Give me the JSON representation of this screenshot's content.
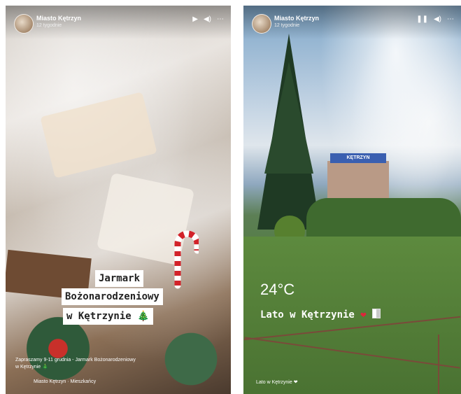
{
  "left_story": {
    "account_name": "Miasto Kętrzyn",
    "account_sub": "12 tygodnie",
    "controls": {
      "play": "▶",
      "sound": "◀)",
      "more": "⋯"
    },
    "caption_lines": [
      "Jarmark",
      "Bożonarodzeniowy",
      "w Kętrzynie 🎄"
    ],
    "bottom_line1": "Zapraszamy 9-11 grudnia - Jarmark Bożonarodzeniowy",
    "bottom_line2": "w Kętrzynie 🎄",
    "bottom_meta": "Miasto Kętrzyn · Mieszkańcy",
    "icons": [
      "candy-cane-icon",
      "christmas-tree-icon"
    ]
  },
  "right_story": {
    "account_name": "Miasto Kętrzyn",
    "account_sub": "12 tygodnie",
    "controls": {
      "pause": "❚❚",
      "sound": "◀)",
      "more": "⋯"
    },
    "building_sign": "KĘTRZYN",
    "temperature": "24°C",
    "caption": "Lato w Kętrzynie",
    "caption_heart": "❤",
    "bottom_line": "Lato w Kętrzynie ❤"
  }
}
